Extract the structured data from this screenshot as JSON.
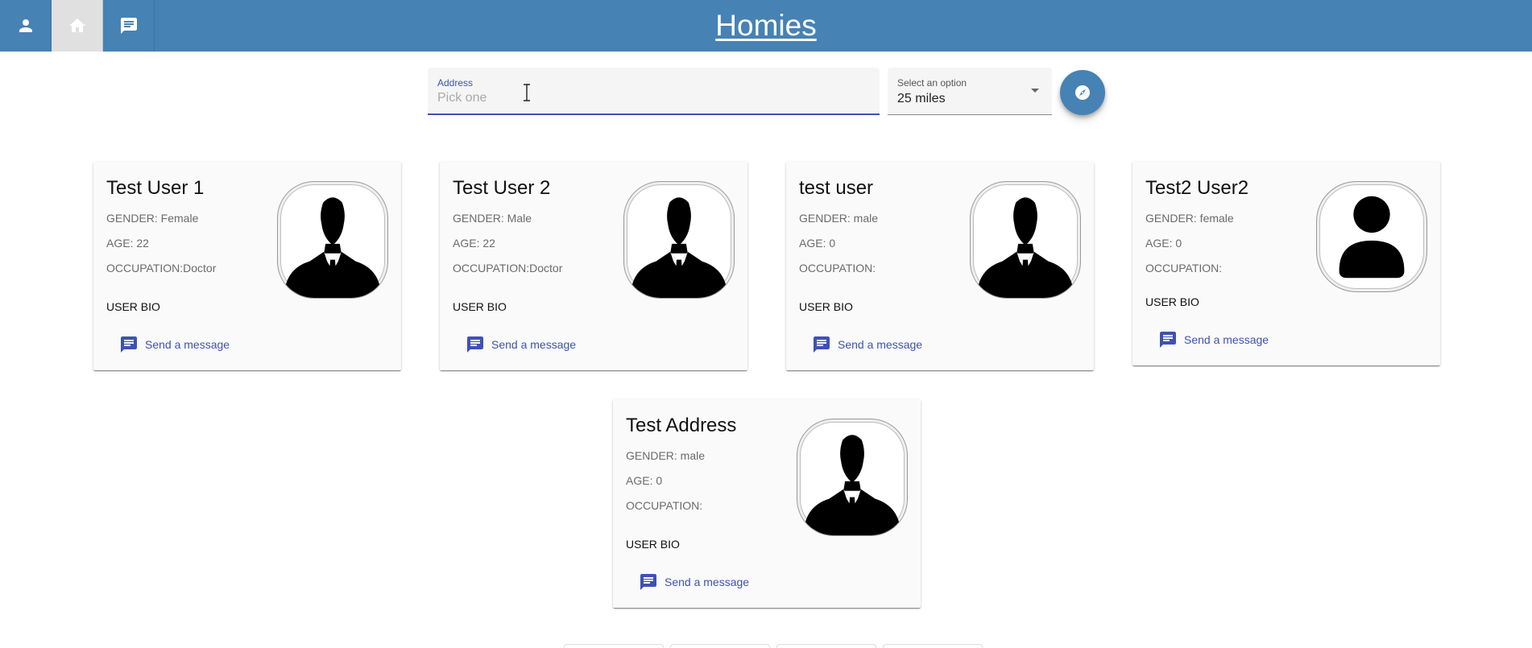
{
  "header": {
    "title": "Homies",
    "nav": [
      {
        "icon": "person-icon"
      },
      {
        "icon": "home-icon",
        "active": true
      },
      {
        "icon": "chat-icon"
      }
    ],
    "bar_color": "#4682b4"
  },
  "search": {
    "address_label": "Address",
    "address_placeholder": "Pick one",
    "address_value": "",
    "radius_label": "Select an option",
    "radius_value": "25 miles",
    "submit_icon": "compass-icon"
  },
  "cards": [
    {
      "name": "Test User 1",
      "gender": "GENDER: Female",
      "age": "AGE: 22",
      "occupation": "OCCUPATION:Doctor",
      "bio": "USER BIO",
      "message_label": "Send a message",
      "avatar_icon": "businessman-silhouette-icon"
    },
    {
      "name": "Test User 2",
      "gender": "GENDER: Male",
      "age": "AGE: 22",
      "occupation": "OCCUPATION:Doctor",
      "bio": "USER BIO",
      "message_label": "Send a message",
      "avatar_icon": "businessman-silhouette-icon"
    },
    {
      "name": "test user",
      "gender": "GENDER: male",
      "age": "AGE: 0",
      "occupation": "OCCUPATION:",
      "bio": "USER BIO",
      "message_label": "Send a message",
      "avatar_icon": "businessman-silhouette-icon"
    },
    {
      "name": "Test2 User2",
      "gender": "GENDER: female",
      "age": "AGE: 0",
      "occupation": "OCCUPATION:",
      "bio": "USER BIO",
      "message_label": "Send a message",
      "avatar_icon": "generic-person-icon"
    },
    {
      "name": "Test Address",
      "gender": "GENDER: male",
      "age": "AGE: 0",
      "occupation": "OCCUPATION:",
      "bio": "USER BIO",
      "message_label": "Send a message",
      "avatar_icon": "businessman-silhouette-icon"
    }
  ],
  "colors": {
    "accent": "#3f51b5",
    "primary": "#4682b4"
  }
}
